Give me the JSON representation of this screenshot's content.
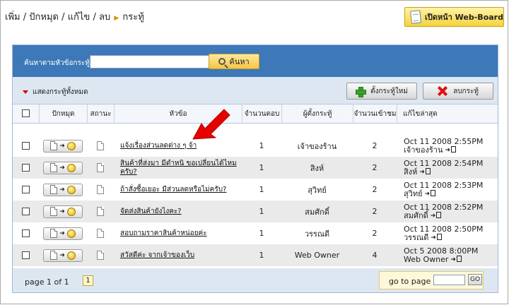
{
  "breadcrumb": {
    "items": [
      "เพิ่ม",
      "ปักหมุด",
      "แก้ไข",
      "ลบ"
    ],
    "current": "กระทู้"
  },
  "header": {
    "webboard_button": "เปิดหน้า Web-Board"
  },
  "search": {
    "label": "ค้นหาตามหัวข้อกระทู้",
    "value": "",
    "button": "ค้นหา"
  },
  "toolbar": {
    "show_all": "แสดงกระทู้ทั้งหมด",
    "new_topic": "ตั้งกระทู้ใหม่",
    "delete_topic": "ลบกระทู้"
  },
  "columns": {
    "pin": "ปักหมุด",
    "status": "สถานะ",
    "topic": "หัวข้อ",
    "replies": "จำนวนตอบ",
    "author": "ผู้ตั้งกระทู้",
    "views": "จำนวนเข้าชม",
    "last_post": "แก้ไขล่าสุด"
  },
  "rows": [
    {
      "topic": "แจ้งเรื่องส่วนลดต่าง ๆ จ้า",
      "replies": "1",
      "author": "เจ้าของร้าน",
      "views": "2",
      "last_date": "Oct 11 2008 2:55PM",
      "last_by": "เจ้าของร้าน"
    },
    {
      "topic": "สินค้าที่ส่งมา มีตำหนิ ขอเปลี่ยนได้ไหมครับ?",
      "replies": "1",
      "author": "สิงห์",
      "views": "2",
      "last_date": "Oct 11 2008 2:54PM",
      "last_by": "สิงห์"
    },
    {
      "topic": "ถ้าสั่งซื้อเยอะ มีส่วนลดหรือไม่ครับ?",
      "replies": "1",
      "author": "สุวิทย์",
      "views": "2",
      "last_date": "Oct 11 2008 2:53PM",
      "last_by": "สุวิทย์"
    },
    {
      "topic": "จัดส่งสินค้ายังไงคะ?",
      "replies": "1",
      "author": "สมศักดิ์",
      "views": "2",
      "last_date": "Oct 11 2008 2:52PM",
      "last_by": "สมศักดิ์"
    },
    {
      "topic": "สอบถามราคาสินค้าหน่อยค่ะ",
      "replies": "1",
      "author": "วรรณดี",
      "views": "2",
      "last_date": "Oct 11 2008 2:50PM",
      "last_by": "วรรณดี"
    },
    {
      "topic": "สวัสดีค่ะ จากเจ้าของเว็บ",
      "replies": "1",
      "author": "Web Owner",
      "views": "4",
      "last_date": "Oct 5 2008 8:00PM",
      "last_by": "Web Owner"
    }
  ],
  "pager": {
    "page_of": "page 1 of 1",
    "current_page": "1",
    "goto_label": "go to page",
    "goto_button": "GO"
  },
  "colors": {
    "search_bar": "#3d78b8",
    "panel_bg": "#dde7f2",
    "accent_yellow": "#f5c640",
    "arrow_red": "#e60000"
  }
}
